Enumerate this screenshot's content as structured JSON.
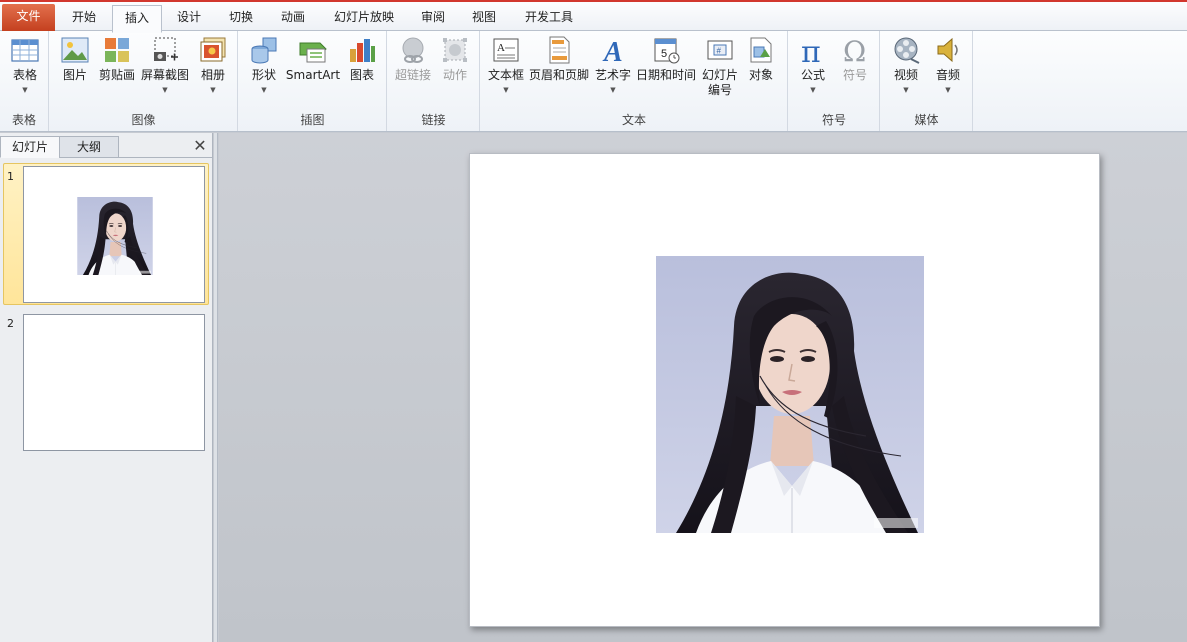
{
  "ribbon_tabs": {
    "file": "文件",
    "home": "开始",
    "insert": "插入",
    "design": "设计",
    "transitions": "切换",
    "animations": "动画",
    "slideshow": "幻灯片放映",
    "review": "审阅",
    "view": "视图",
    "developer": "开发工具"
  },
  "active_tab": "插入",
  "ribbon": {
    "tables": {
      "label": "表格",
      "table": "表格"
    },
    "images": {
      "label": "图像",
      "picture": "图片",
      "clipart": "剪贴画",
      "screenshot": "屏幕截图",
      "album": "相册"
    },
    "illustrations": {
      "label": "插图",
      "shapes": "形状",
      "smartart": "SmartArt",
      "chart": "图表"
    },
    "links": {
      "label": "链接",
      "hyperlink": "超链接",
      "action": "动作"
    },
    "text": {
      "label": "文本",
      "textbox": "文本框",
      "header_footer": "页眉和页脚",
      "wordart": "艺术字",
      "datetime": "日期和时间",
      "slide_number_1": "幻灯片",
      "slide_number_2": "编号",
      "object": "对象"
    },
    "symbols": {
      "label": "符号",
      "equation": "公式",
      "symbol": "符号"
    },
    "media": {
      "label": "媒体",
      "video": "视频",
      "audio": "音频"
    }
  },
  "colors": {
    "file_tab": "#d2502a",
    "accent_red": "#d2372e",
    "selected_thumb": "#ffe59a"
  },
  "pane": {
    "tab_slides": "幻灯片",
    "tab_outline": "大纲",
    "close": "✕",
    "slides": [
      {
        "number": "1",
        "selected": true,
        "has_image": true
      },
      {
        "number": "2",
        "selected": false,
        "has_image": false
      }
    ]
  }
}
